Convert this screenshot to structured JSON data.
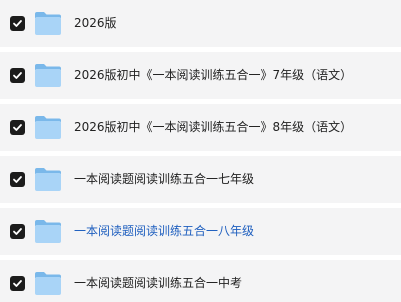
{
  "items": [
    {
      "label": "2026版",
      "checked": true,
      "active": false
    },
    {
      "label": "2026版初中《一本阅读训练五合一》7年级（语文）",
      "checked": true,
      "active": false
    },
    {
      "label": "2026版初中《一本阅读训练五合一》8年级（语文）",
      "checked": true,
      "active": false
    },
    {
      "label": "一本阅读题阅读训练五合一七年级",
      "checked": true,
      "active": false
    },
    {
      "label": "一本阅读题阅读训练五合一八年级",
      "checked": true,
      "active": true
    },
    {
      "label": "一本阅读题阅读训练五合一中考",
      "checked": true,
      "active": false
    }
  ],
  "colors": {
    "row_bg": "#f4f4f5",
    "checkbox": "#1c1c1c",
    "folder_light": "#a9d4f7",
    "folder_dark": "#7ab8ea",
    "text": "#222222",
    "active_text": "#1f5fbf"
  }
}
